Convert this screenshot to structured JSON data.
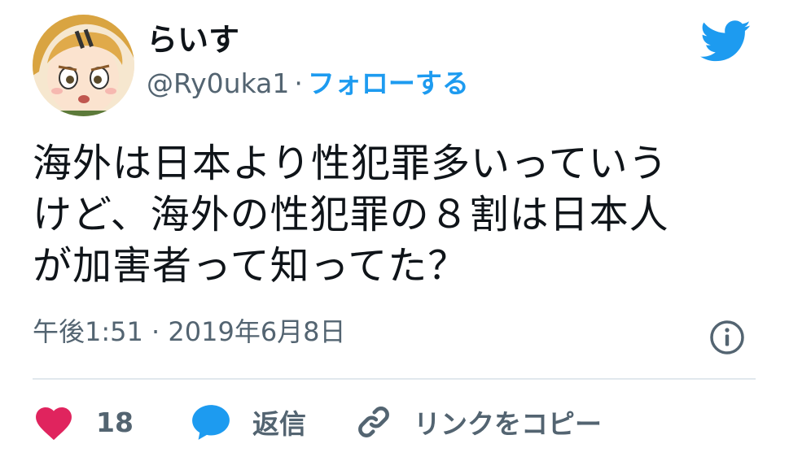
{
  "user": {
    "display_name": "らいす",
    "handle": "@Ry0uka1",
    "separator": "·",
    "follow_label": "フォローする"
  },
  "tweet": {
    "lines": [
      "海外は日本より性犯罪多いっていう",
      "けど、海外の性犯罪の８割は日本人",
      "が加害者って知ってた？"
    ],
    "timestamp": "午後1:51 · 2019年6月8日"
  },
  "actions": {
    "like_count": "18",
    "reply_label": "返信",
    "copy_link_label": "リンクをコピー"
  },
  "colors": {
    "twitter_blue": "#1d9bf0",
    "like_pink": "#e0245e",
    "reply_blue": "#1d9bf0",
    "secondary_text": "#536471"
  },
  "icons": {
    "logo": "twitter-bird-icon",
    "info": "info-icon",
    "like": "heart-icon",
    "reply": "speech-bubble-icon",
    "link": "link-icon"
  }
}
